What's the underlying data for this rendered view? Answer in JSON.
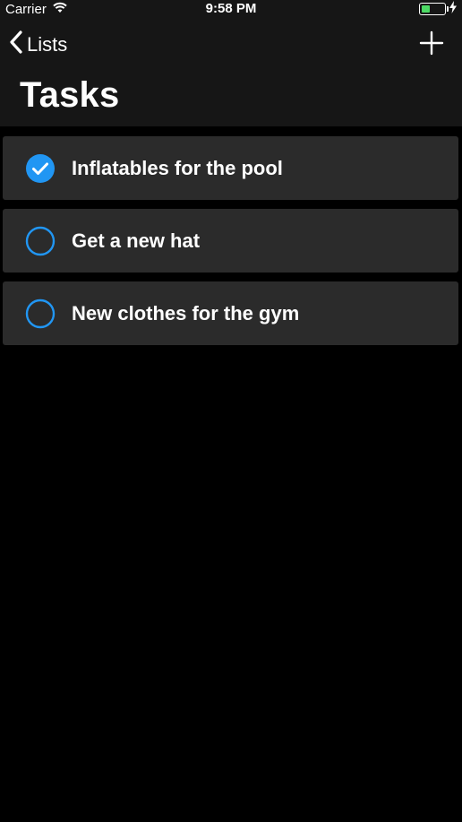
{
  "status_bar": {
    "carrier": "Carrier",
    "time": "9:58 PM",
    "icons": [
      "wifi-icon",
      "battery-icon",
      "charging-bolt-icon"
    ]
  },
  "nav": {
    "back_label": "Lists",
    "title": "Tasks",
    "add_icon": "plus-icon"
  },
  "tasks": [
    {
      "label": "Inflatables for the pool",
      "completed": true
    },
    {
      "label": "Get a new hat",
      "completed": false
    },
    {
      "label": "New clothes for the gym",
      "completed": false
    }
  ],
  "colors": {
    "accent": "#2196f3",
    "row_background": "#2b2b2b",
    "bar_background": "#161616",
    "page_background": "#000000",
    "battery_fill": "#4cd964"
  }
}
